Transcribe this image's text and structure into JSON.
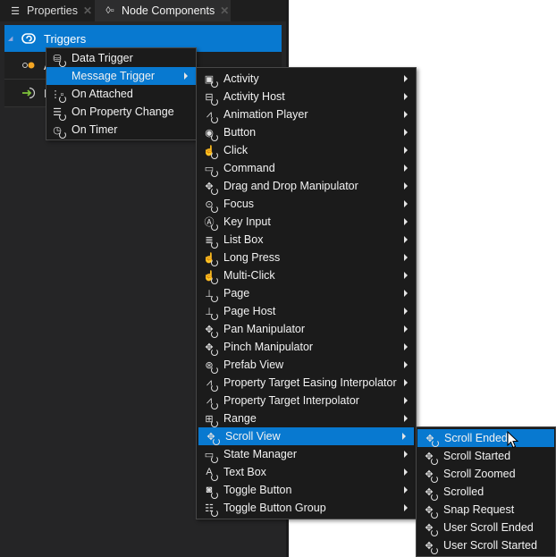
{
  "tabs": [
    {
      "label": "Properties",
      "icon": "list-icon",
      "active": false
    },
    {
      "label": "Node Components",
      "icon": "node-components-icon",
      "active": true
    }
  ],
  "tree": [
    {
      "label": "Triggers",
      "icon": "trigger-icon",
      "selected": true,
      "expanded": true
    },
    {
      "label": "A",
      "icon": "action-icon",
      "selected": false
    },
    {
      "label": "I",
      "icon": "input-icon",
      "selected": false
    }
  ],
  "trigger_menu": {
    "items": [
      {
        "label": "Data Trigger",
        "icon": "data-trigger-icon",
        "submenu": false
      },
      {
        "label": "Message Trigger",
        "icon": "",
        "submenu": true,
        "highlighted": true
      },
      {
        "label": "On Attached",
        "icon": "on-attached-icon",
        "submenu": false
      },
      {
        "label": "On Property Change",
        "icon": "on-property-change-icon",
        "submenu": false
      },
      {
        "label": "On Timer",
        "icon": "on-timer-icon",
        "submenu": false
      }
    ]
  },
  "message_menu": {
    "items": [
      {
        "label": "Activity",
        "icon": "activity-icon"
      },
      {
        "label": "Activity Host",
        "icon": "activity-host-icon"
      },
      {
        "label": "Animation Player",
        "icon": "animation-player-icon"
      },
      {
        "label": "Button",
        "icon": "button-icon"
      },
      {
        "label": "Click",
        "icon": "click-icon"
      },
      {
        "label": "Command",
        "icon": "command-icon"
      },
      {
        "label": "Drag and Drop Manipulator",
        "icon": "manipulator-icon"
      },
      {
        "label": "Focus",
        "icon": "focus-icon"
      },
      {
        "label": "Key Input",
        "icon": "key-input-icon"
      },
      {
        "label": "List Box",
        "icon": "list-box-icon"
      },
      {
        "label": "Long Press",
        "icon": "long-press-icon"
      },
      {
        "label": "Multi-Click",
        "icon": "multi-click-icon"
      },
      {
        "label": "Page",
        "icon": "page-icon"
      },
      {
        "label": "Page Host",
        "icon": "page-host-icon"
      },
      {
        "label": "Pan Manipulator",
        "icon": "manipulator-icon"
      },
      {
        "label": "Pinch Manipulator",
        "icon": "manipulator-icon"
      },
      {
        "label": "Prefab View",
        "icon": "prefab-view-icon"
      },
      {
        "label": "Property Target Easing Interpolator",
        "icon": "interpolator-icon"
      },
      {
        "label": "Property Target Interpolator",
        "icon": "interpolator-icon"
      },
      {
        "label": "Range",
        "icon": "range-icon"
      },
      {
        "label": "Scroll View",
        "icon": "manipulator-icon",
        "highlighted": true
      },
      {
        "label": "State Manager",
        "icon": "state-manager-icon"
      },
      {
        "label": "Text Box",
        "icon": "text-box-icon"
      },
      {
        "label": "Toggle Button",
        "icon": "toggle-button-icon"
      },
      {
        "label": "Toggle Button Group",
        "icon": "toggle-button-group-icon"
      }
    ]
  },
  "scroll_menu": {
    "items": [
      {
        "label": "Scroll Ended",
        "highlighted": true
      },
      {
        "label": "Scroll Started"
      },
      {
        "label": "Scroll Zoomed"
      },
      {
        "label": "Scrolled"
      },
      {
        "label": "Snap Request"
      },
      {
        "label": "User Scroll Ended"
      },
      {
        "label": "User Scroll Started"
      }
    ]
  },
  "colors": {
    "accent": "#0879d0",
    "panel_bg": "#252526",
    "menu_bg": "#1b1b1b",
    "menu_border": "#474747",
    "action_dot": "#f5a623",
    "input_arrow": "#7ec23a"
  }
}
